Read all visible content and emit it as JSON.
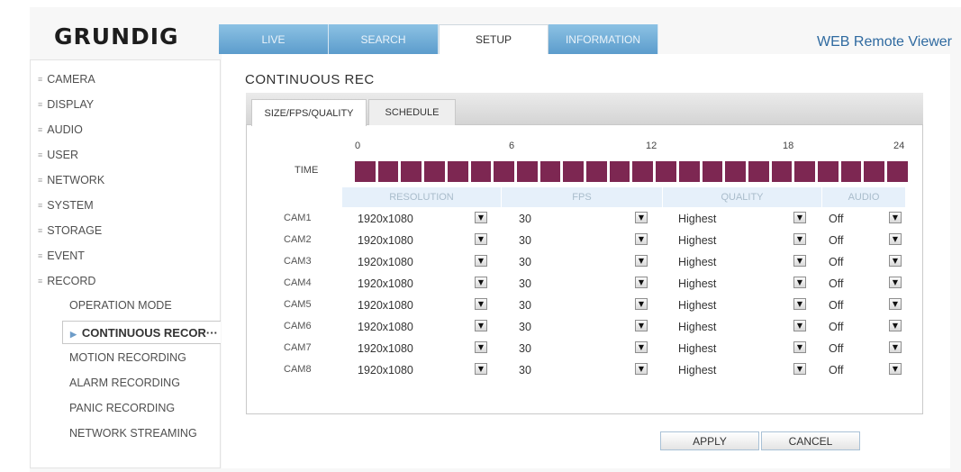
{
  "header": {
    "logo": "GRUNDIG",
    "product": "WEB Remote Viewer",
    "tabs": [
      {
        "label": "LIVE",
        "active": false
      },
      {
        "label": "SEARCH",
        "active": false
      },
      {
        "label": "SETUP",
        "active": true
      },
      {
        "label": "INFORMATION",
        "active": false
      }
    ]
  },
  "sidebar": {
    "items": [
      "CAMERA",
      "DISPLAY",
      "AUDIO",
      "USER",
      "NETWORK",
      "SYSTEM",
      "STORAGE",
      "EVENT",
      "RECORD"
    ],
    "sub_items": [
      "OPERATION MODE",
      "CONTINUOUS RECOR···",
      "MOTION RECORDING",
      "ALARM RECORDING",
      "PANIC RECORDING",
      "NETWORK STREAMING"
    ],
    "active_sub_index": 1
  },
  "main": {
    "title": "CONTINUOUS REC",
    "subtabs": [
      "SIZE/FPS/QUALITY",
      "SCHEDULE"
    ],
    "time_label": "TIME",
    "hour_marks": [
      "0",
      "6",
      "12",
      "18",
      "24"
    ],
    "columns": [
      "RESOLUTION",
      "FPS",
      "QUALITY",
      "AUDIO"
    ],
    "rows": [
      {
        "cam": "CAM1",
        "resolution": "1920x1080",
        "fps": "30",
        "quality": "Highest",
        "audio": "Off"
      },
      {
        "cam": "CAM2",
        "resolution": "1920x1080",
        "fps": "30",
        "quality": "Highest",
        "audio": "Off"
      },
      {
        "cam": "CAM3",
        "resolution": "1920x1080",
        "fps": "30",
        "quality": "Highest",
        "audio": "Off"
      },
      {
        "cam": "CAM4",
        "resolution": "1920x1080",
        "fps": "30",
        "quality": "Highest",
        "audio": "Off"
      },
      {
        "cam": "CAM5",
        "resolution": "1920x1080",
        "fps": "30",
        "quality": "Highest",
        "audio": "Off"
      },
      {
        "cam": "CAM6",
        "resolution": "1920x1080",
        "fps": "30",
        "quality": "Highest",
        "audio": "Off"
      },
      {
        "cam": "CAM7",
        "resolution": "1920x1080",
        "fps": "30",
        "quality": "Highest",
        "audio": "Off"
      },
      {
        "cam": "CAM8",
        "resolution": "1920x1080",
        "fps": "30",
        "quality": "Highest",
        "audio": "Off"
      }
    ],
    "buttons": {
      "apply": "APPLY",
      "cancel": "CANCEL"
    }
  },
  "colors": {
    "timebar": "#7d2752",
    "tab_blue": "#5c9ccc",
    "header_blue": "#2f6aa0"
  }
}
